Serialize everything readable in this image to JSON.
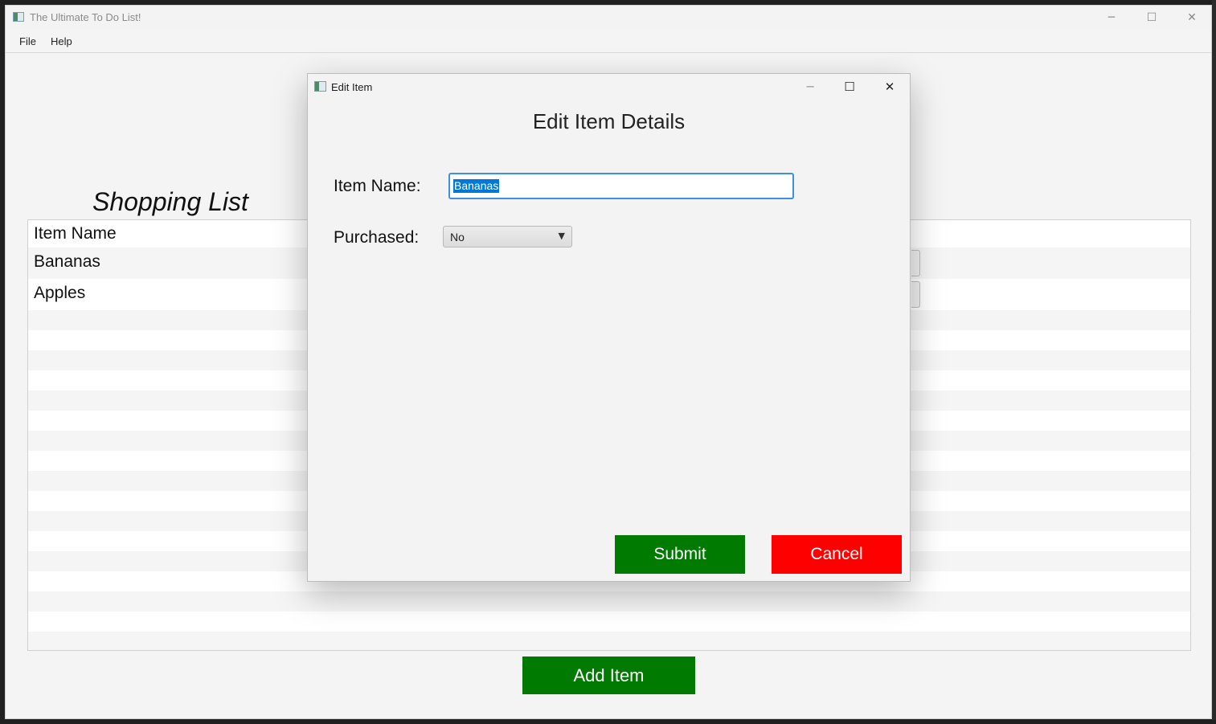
{
  "main_window": {
    "title": "The Ultimate To Do List!",
    "controls": {
      "minimize": "─",
      "maximize": "☐",
      "close": "✕"
    },
    "menu": [
      "File",
      "Help"
    ],
    "list_title": "Shopping List",
    "table": {
      "column_header": "Item Name",
      "rows": [
        "Bananas",
        "Apples"
      ]
    },
    "add_button_label": "Add Item"
  },
  "dialog": {
    "title": "Edit Item",
    "controls": {
      "minimize": "─",
      "maximize": "☐",
      "close": "✕"
    },
    "heading": "Edit Item Details",
    "item_name_label": "Item Name:",
    "item_name_value": "Bananas",
    "purchased_label": "Purchased:",
    "purchased_value": "No",
    "submit_label": "Submit",
    "cancel_label": "Cancel"
  },
  "colors": {
    "accent_green": "#007a00",
    "cancel_red": "#ff0000",
    "focus_blue": "#3d8fe0"
  }
}
